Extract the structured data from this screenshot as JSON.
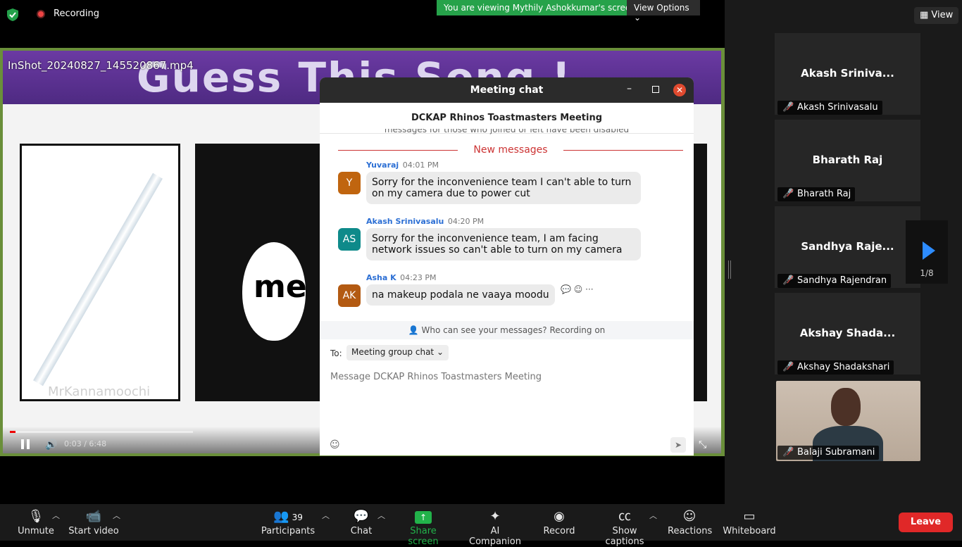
{
  "top": {
    "recording_label": "Recording",
    "viewing_banner": "You are viewing Mythily Ashokkumar's screen",
    "view_options": "View Options",
    "view_button": "View"
  },
  "video": {
    "filename": "InShot_20240827_145520867.mp4",
    "banner_title": "Guess This Song !",
    "watermark": "MrKannamoochi",
    "time": "0:03 / 6:48",
    "progress": 0.0075,
    "logo_text": "me"
  },
  "chat": {
    "window_title": "Meeting chat",
    "subtitle": "DCKAP Rhinos Toastmasters Meeting",
    "hidden_note": "messages for those who joined or left have been disabled",
    "new_messages": "New messages",
    "messages": [
      {
        "initials": "Y",
        "name": "Yuvaraj",
        "time": "04:01 PM",
        "text": "Sorry for the inconvenience team I can't able to turn on my camera due to power cut",
        "color": "#c0650f"
      },
      {
        "initials": "AS",
        "name": "Akash Srinivasalu",
        "time": "04:20 PM",
        "text": "Sorry for the inconvenience team, I am facing network issues so can't able to turn on my camera",
        "color": "#0e8a8a"
      },
      {
        "initials": "AK",
        "name": "Asha K",
        "time": "04:23 PM",
        "text": "na makeup podala ne vaaya moodu",
        "color": "#b35a12"
      }
    ],
    "privacy_note": "Who can see your messages? Recording on",
    "to_label": "To:",
    "to_value": "Meeting group chat",
    "input_placeholder": "Message DCKAP Rhinos Toastmasters Meeting"
  },
  "gallery": {
    "tiles": [
      {
        "display": "Akash Sriniva...",
        "label": "Akash Srinivasalu"
      },
      {
        "display": "Bharath Raj",
        "label": "Bharath Raj"
      },
      {
        "display": "Sandhya Raje...",
        "label": "Sandhya Rajendran"
      },
      {
        "display": "Akshay Shada...",
        "label": "Akshay Shadakshari"
      }
    ],
    "video_tile_label": "Balaji Subramani",
    "page_indicator": "1/8"
  },
  "toolbar": {
    "unmute": "Unmute",
    "start_video": "Start video",
    "participants": "Participants",
    "participants_count": "39",
    "chat": "Chat",
    "share_screen": "Share screen",
    "ai_companion": "AI Companion",
    "record": "Record",
    "show_captions": "Show captions",
    "reactions": "Reactions",
    "whiteboard": "Whiteboard",
    "leave": "Leave"
  },
  "colors": {
    "accent_blue": "#2d8cff",
    "share_green": "#22b24a",
    "leave_red": "#e02828",
    "new_messages_red": "#cc3333"
  }
}
